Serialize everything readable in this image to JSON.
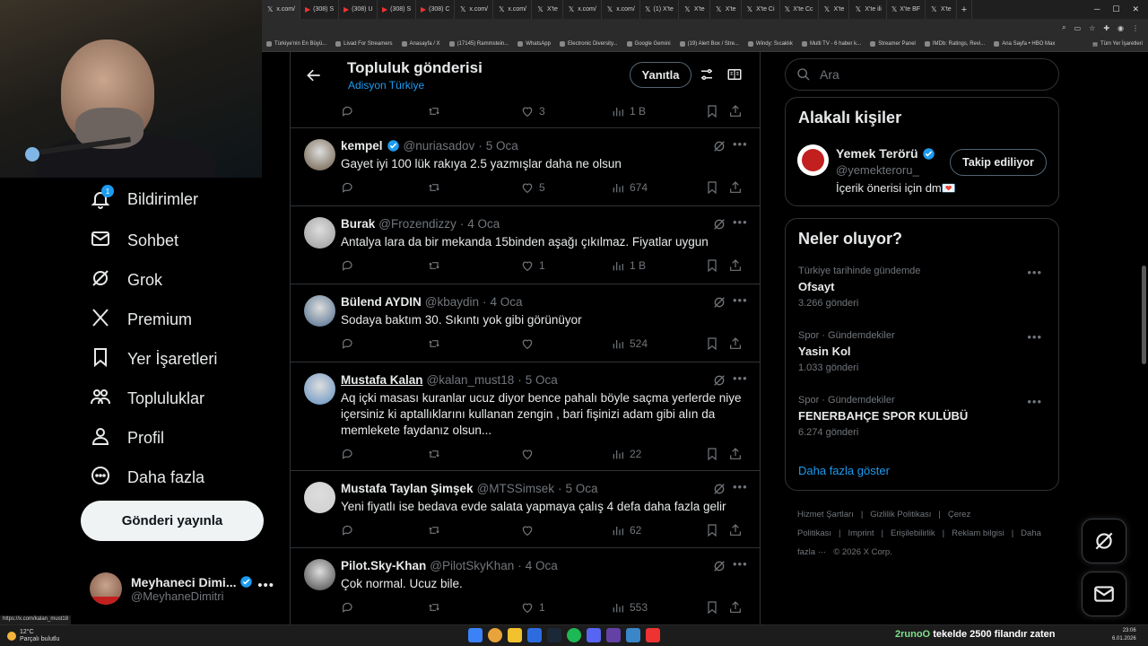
{
  "browser": {
    "tabs": [
      {
        "label": "x.com/",
        "icon": "x-icon"
      },
      {
        "label": "(308) S",
        "icon": "youtube-icon"
      },
      {
        "label": "(308) U",
        "icon": "youtube-icon"
      },
      {
        "label": "(308) S",
        "icon": "youtube-icon"
      },
      {
        "label": "(308) C",
        "icon": "youtube-icon"
      },
      {
        "label": "x.com/",
        "icon": "x-icon"
      },
      {
        "label": "x.com/",
        "icon": "x-icon"
      },
      {
        "label": "X'te",
        "icon": "x-icon"
      },
      {
        "label": "x.com/",
        "icon": "x-icon"
      },
      {
        "label": "x.com/",
        "icon": "x-icon"
      },
      {
        "label": "(1) X'te",
        "icon": "x-icon"
      },
      {
        "label": "X'te",
        "icon": "x-icon"
      },
      {
        "label": "X'te",
        "icon": "x-icon"
      },
      {
        "label": "X'te Ci",
        "icon": "x-icon"
      },
      {
        "label": "X'te Cc",
        "icon": "x-icon"
      },
      {
        "label": "X'te",
        "icon": "x-icon"
      },
      {
        "label": "X'te ili",
        "icon": "x-icon"
      },
      {
        "label": "X'te BF",
        "icon": "x-icon"
      },
      {
        "label": "X'te",
        "icon": "x-icon"
      }
    ],
    "bookmarks": [
      "Türkiye'nin En Büyü...",
      "Livad For Streamers",
      "Anasayfa / X",
      "(17145) Rammstein...",
      "WhatsApp",
      "Electronic Diversity...",
      "Google Gemini",
      "(19) Alert Box / Stre...",
      "Windy: Sıcaklık",
      "Multi TV - 6 haber k...",
      "Streamer Panel",
      "IMDb: Ratings, Revi...",
      "Ana Sayfa • HBO Max"
    ],
    "bookmarks_all": "Tüm Yer İşaretleri",
    "status_url": "https://x.com/kalan_must18"
  },
  "sidebar": {
    "items": [
      {
        "label": "Bildirimler",
        "icon": "bell-icon",
        "badge": "1"
      },
      {
        "label": "Sohbet",
        "icon": "mail-icon"
      },
      {
        "label": "Grok",
        "icon": "grok-icon"
      },
      {
        "label": "Premium",
        "icon": "x-logo-icon"
      },
      {
        "label": "Yer İşaretleri",
        "icon": "bookmark-icon"
      },
      {
        "label": "Topluluklar",
        "icon": "people-icon"
      },
      {
        "label": "Profil",
        "icon": "person-icon"
      },
      {
        "label": "Daha fazla",
        "icon": "more-circle-icon"
      }
    ],
    "post_button": "Gönderi yayınla",
    "account": {
      "name": "Meyhaneci Dimi...",
      "handle": "@MeyhaneDimitri"
    }
  },
  "header": {
    "title": "Topluluk gönderisi",
    "subtitle": "Adisyon Türkiye",
    "reply_button": "Yanıtla"
  },
  "top_actions": {
    "likes": "3",
    "views": "1 B"
  },
  "tweets": [
    {
      "name": "kempel",
      "verified": true,
      "handle": "@nuriasadov",
      "time": "5 Oca",
      "text": "Gayet iyi 100 lük rakıya 2.5 yazmışlar daha ne olsun",
      "likes": "5",
      "views": "674",
      "avatar_color": "#6b5a44"
    },
    {
      "name": "Burak",
      "verified": false,
      "handle": "@Frozendizzy",
      "time": "4 Oca",
      "text": "Antalya lara da bir mekanda 15binden aşağı çıkılmaz. Fiyatlar uygun",
      "likes": "1",
      "views": "1 B",
      "avatar_color": "#9a9a9a"
    },
    {
      "name": "Bülend AYDIN",
      "verified": false,
      "handle": "@kbaydin",
      "time": "4 Oca",
      "text": "Sodaya baktım 30. Sıkıntı yok gibi görünüyor",
      "likes": "",
      "views": "524",
      "avatar_color": "#4a6a8a"
    },
    {
      "name": "Mustafa Kalan",
      "verified": false,
      "handle": "@kalan_must18",
      "time": "5 Oca",
      "text": "Aq içki masası kuranlar ucuz diyor bence pahalı böyle saçma yerlerde niye içersiniz ki aptallıklarını kullanan zengin , bari fişinizi adam gibi alın da memlekete faydanız olsun...",
      "likes": "",
      "views": "22",
      "avatar_color": "#5f8fc2"
    },
    {
      "name": "Mustafa Taylan Şimşek",
      "verified": false,
      "handle": "@MTSSimsek",
      "time": "5 Oca",
      "text": "Yeni fiyatlı ise bedava evde salata yapmaya çalış 4 defa daha fazla gelir",
      "likes": "",
      "views": "62",
      "avatar_color": "#cfcfcf"
    },
    {
      "name": "Pilot.Sky-Khan",
      "verified": false,
      "handle": "@PilotSkyKhan",
      "time": "4 Oca",
      "text": "Çok normal. Ucuz bile.",
      "likes": "1",
      "views": "553",
      "avatar_color": "#444"
    }
  ],
  "right": {
    "search_placeholder": "Ara",
    "related_title": "Alakalı kişiler",
    "related_person": {
      "name": "Yemek Terörü",
      "handle": "@yemekteroru_",
      "bio": "İçerik önerisi için dm💌",
      "follow_button": "Takip ediliyor"
    },
    "trends_title": "Neler oluyor?",
    "trends": [
      {
        "context": "Türkiye tarihinde gündemde",
        "name": "Ofsayt",
        "count": "3.266 gönderi"
      },
      {
        "context": "Spor · Gündemdekiler",
        "name": "Yasin Kol",
        "count": "1.033 gönderi"
      },
      {
        "context": "Spor · Gündemdekiler",
        "name": "FENERBAHÇE SPOR KULÜBÜ",
        "count": "6.274 gönderi"
      }
    ],
    "show_more": "Daha fazla göster",
    "footer": [
      "Hizmet Şartları",
      "|",
      "Gizlilik Politikası",
      "|",
      "Çerez Politikası",
      "|",
      "Imprint",
      "|",
      "Erişilebilirlik",
      "|",
      "Reklam bilgisi",
      "|",
      "Daha fazla ···",
      "© 2026 X Corp."
    ]
  },
  "taskbar": {
    "weather_temp": "12°C",
    "weather_desc": "Parçalı bulutlu",
    "ticker_user": "2runoO",
    "ticker_text": "tekelde 2500 filandır zaten",
    "time": "23:06",
    "date": "6.01.2026"
  },
  "colors": {
    "accent": "#1d9bf0",
    "muted": "#71767b",
    "border": "#2f3336"
  }
}
